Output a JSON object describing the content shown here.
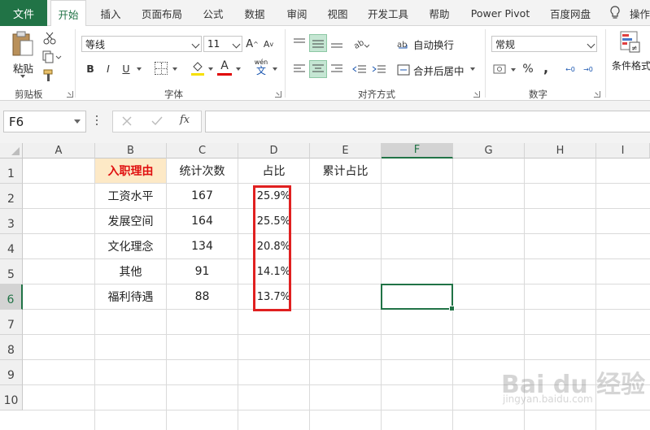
{
  "tabs": {
    "file": "文件",
    "items": [
      "开始",
      "插入",
      "页面布局",
      "公式",
      "数据",
      "审阅",
      "视图",
      "开发工具",
      "帮助",
      "Power Pivot",
      "百度网盘"
    ],
    "active": "开始",
    "tell_me": "操作"
  },
  "ribbon": {
    "clipboard": {
      "paste": "粘贴",
      "label": "剪贴板"
    },
    "font": {
      "name": "等线",
      "size": "11",
      "grow": "A",
      "shrink": "A",
      "bold": "B",
      "italic": "I",
      "underline": "U",
      "fill_label": "A",
      "wen": "wén",
      "wen_char": "文",
      "label": "字体"
    },
    "alignment": {
      "wrap": "自动换行",
      "merge": "合并后居中",
      "label": "对齐方式"
    },
    "number": {
      "format": "常规",
      "percent": "%",
      "comma": ",",
      "label": "数字",
      "inc_decimal": "←0",
      "dec_decimal": "→0"
    },
    "styles": {
      "conditional": "条件格式"
    }
  },
  "formula_bar": {
    "name_box": "F6",
    "fx": "fx",
    "value": ""
  },
  "columns": [
    "A",
    "B",
    "C",
    "D",
    "E",
    "F",
    "G",
    "H",
    "I"
  ],
  "active_column": "F",
  "rows": [
    "1",
    "2",
    "3",
    "4",
    "5",
    "6",
    "7",
    "8",
    "9",
    "10"
  ],
  "active_row": "6",
  "table": {
    "headers": [
      "入职理由",
      "统计次数",
      "占比",
      "累计占比"
    ],
    "rows": [
      {
        "reason": "工资水平",
        "count": "167",
        "ratio": "25.9%"
      },
      {
        "reason": "发展空间",
        "count": "164",
        "ratio": "25.5%"
      },
      {
        "reason": "文化理念",
        "count": "134",
        "ratio": "20.8%"
      },
      {
        "reason": "其他",
        "count": "91",
        "ratio": "14.1%"
      },
      {
        "reason": "福利待遇",
        "count": "88",
        "ratio": "13.7%"
      }
    ]
  },
  "watermark": {
    "main": "Bai du 经验",
    "sub": "jingyan.baidu.com"
  },
  "colors": {
    "accent": "#217346",
    "highlight_red": "#e02020",
    "header_fill": "#fde9c6",
    "header_text": "#e01010"
  }
}
